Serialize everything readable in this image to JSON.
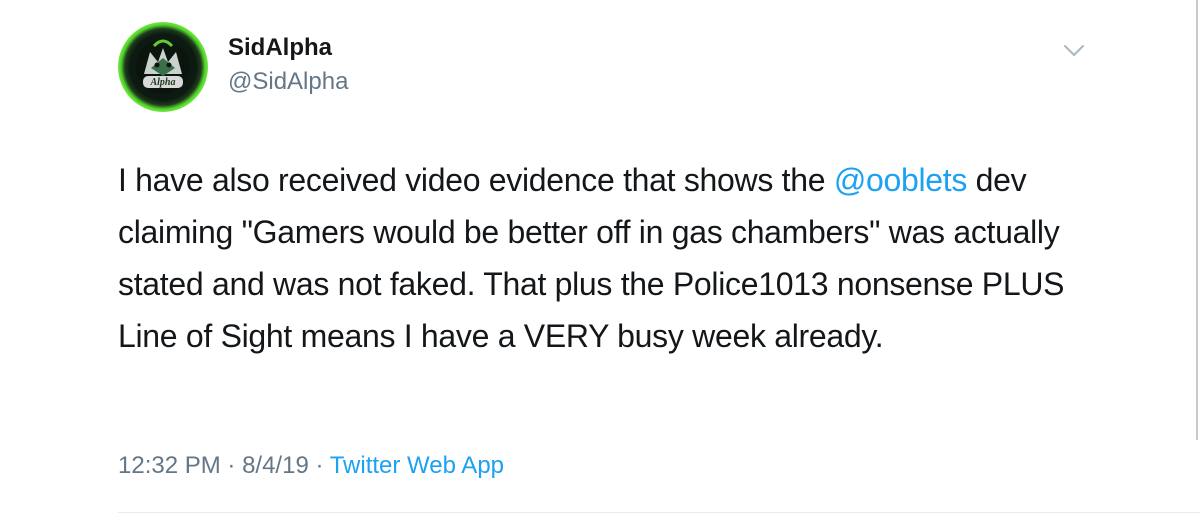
{
  "tweet": {
    "author": {
      "name": "SidAlpha",
      "handle": "@SidAlpha",
      "avatar_label": "Alpha"
    },
    "text_parts": {
      "before_mention": "I have also received video evidence that shows the ",
      "mention": "@ooblets",
      "after_mention": " dev claiming \"Gamers would be better off in gas chambers\" was actually stated and was not faked. That plus the Police1013 nonsense PLUS Line of Sight means I have a VERY busy week already."
    },
    "time": "12:32 PM",
    "separator_1": " · ",
    "date": "8/4/19",
    "separator_2": " · ",
    "source": "Twitter Web App",
    "menu_icon": "chevron-down-icon"
  },
  "colors": {
    "text": "#14171a",
    "secondary": "#657786",
    "link": "#1da1f2",
    "avatar_ring": "#7ef03f"
  }
}
